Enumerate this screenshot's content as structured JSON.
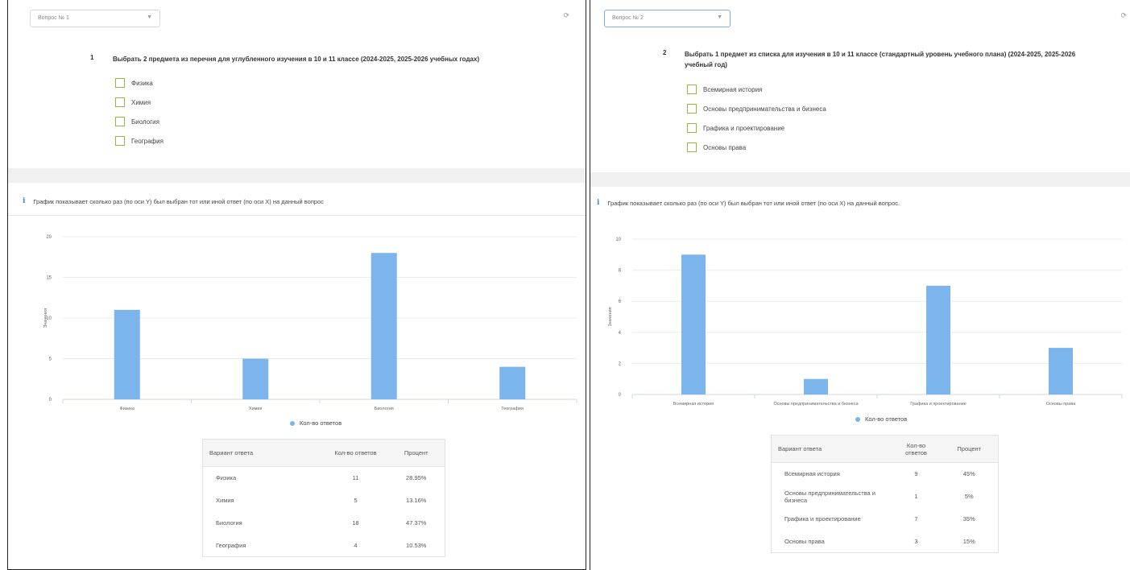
{
  "left": {
    "selector": "Вопрос № 1",
    "question_number": "1",
    "question_text": "Выбрать 2 предмета из перечня для углубленного изучения в 10 и 11 классе (2024-2025, 2025-2026 учебных годах)",
    "options": [
      "Физика",
      "Химия",
      "Биология",
      "География"
    ],
    "info_text": "График показывает сколько раз (по оси Y) был выбран тот или иной ответ (по оси X) на данный вопрос",
    "legend": "Кол-во ответов",
    "table": {
      "headers": [
        "Вариант ответа",
        "Кол-во ответов",
        "Процент"
      ],
      "rows": [
        [
          "Физика",
          "11",
          "28.95%"
        ],
        [
          "Химия",
          "5",
          "13.16%"
        ],
        [
          "Биология",
          "18",
          "47.37%"
        ],
        [
          "География",
          "4",
          "10.53%"
        ]
      ]
    }
  },
  "right": {
    "selector": "Вопрос № 2",
    "question_number": "2",
    "question_text": "Выбрать 1 предмет из списка для изучения в 10 и 11 классе (стандартный уровень учебного плана) (2024-2025, 2025-2026 учебный год)",
    "options": [
      "Всемирная история",
      "Основы предпринимательства и бизнеса",
      "Графика и проектирование",
      "Основы права"
    ],
    "info_text": "График показывает сколько раз (по оси Y) был выбран тот или иной ответ (по оси X) на данный вопрос.",
    "legend": "Кол-во ответов",
    "table": {
      "headers": [
        "Вариант ответа",
        "Кол-во ответов",
        "Процент"
      ],
      "rows": [
        [
          "Всемирная история",
          "9",
          "45%"
        ],
        [
          "Основы предпринимательства и бизнеса",
          "1",
          "5%"
        ],
        [
          "Графика и проектирование",
          "7",
          "35%"
        ],
        [
          "Основы права",
          "3",
          "15%"
        ]
      ]
    }
  },
  "colors": {
    "bar": "#7cb5ec",
    "checkbox": "#8fbe3c",
    "info_icon": "#3b8ed6"
  },
  "chart_data": [
    {
      "type": "bar",
      "categories": [
        "Физика",
        "Химия",
        "Биология",
        "География"
      ],
      "series": [
        {
          "name": "Кол-во ответов",
          "values": [
            11,
            5,
            18,
            4
          ]
        }
      ],
      "ylabel": "Значения",
      "ylim": [
        0,
        20
      ],
      "yticks": [
        0,
        5,
        10,
        15,
        20
      ],
      "grid": true,
      "legend": "bottom-center"
    },
    {
      "type": "bar",
      "categories": [
        "Всемирная история",
        "Основы предпринимательства и бизнеса",
        "Графика и проектирование",
        "Основы права"
      ],
      "series": [
        {
          "name": "Кол-во ответов",
          "values": [
            9,
            1,
            7,
            3
          ]
        }
      ],
      "ylabel": "Значения",
      "ylim": [
        0,
        10
      ],
      "yticks": [
        0,
        2,
        4,
        6,
        8,
        10
      ],
      "grid": true,
      "legend": "bottom-center"
    }
  ]
}
